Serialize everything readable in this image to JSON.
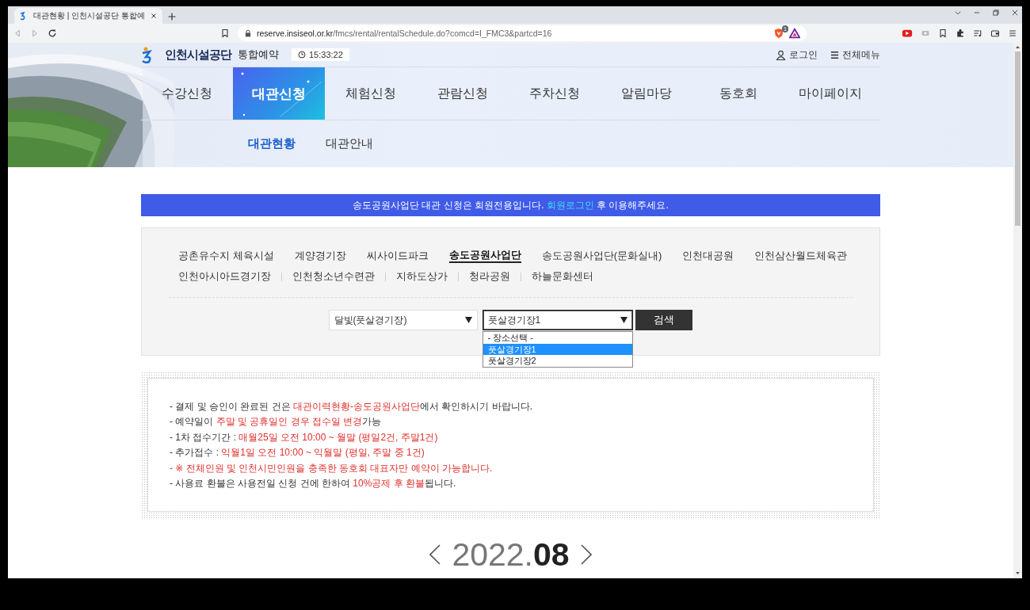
{
  "browser": {
    "tab_title": "대관현황 | 인천시설공단 통합예",
    "url_host": "reserve.insiseol.or.kr",
    "url_path": "/fmcs/rental/rentalSchedule.do?comcd=I_FMC3&partcd=16",
    "shield_badge": "1"
  },
  "header": {
    "logo": "인천시설공단",
    "service": "통합예약",
    "time": "15:33:22",
    "login": "로그인",
    "all_menu": "전체메뉴",
    "nav": [
      {
        "label": "수강신청",
        "selected": false
      },
      {
        "label": "대관신청",
        "selected": true
      },
      {
        "label": "체험신청",
        "selected": false
      },
      {
        "label": "관람신청",
        "selected": false
      },
      {
        "label": "주차신청",
        "selected": false
      },
      {
        "label": "알림마당",
        "selected": false
      },
      {
        "label": "동호회",
        "selected": false
      },
      {
        "label": "마이페이지",
        "selected": false
      }
    ],
    "subnav": [
      {
        "label": "대관현황",
        "selected": true
      },
      {
        "label": "대관안내",
        "selected": false
      }
    ]
  },
  "banner": {
    "before": "송도공원사업단 대관 신청은 회원전용입니다.",
    "link": "회원로그인",
    "after": "후 이용해주세요."
  },
  "facility_rows": [
    [
      {
        "label": "공촌유수지 체육시설",
        "selected": false
      },
      {
        "label": "계양경기장",
        "selected": false
      },
      {
        "label": "씨사이드파크",
        "selected": false
      },
      {
        "label": "송도공원사업단",
        "selected": true
      },
      {
        "label": "송도공원사업단(문화실내)",
        "selected": false
      },
      {
        "label": "인천대공원",
        "selected": false
      },
      {
        "label": "인천삼산월드체육관",
        "selected": false
      }
    ],
    [
      {
        "label": "인천아시아드경기장",
        "selected": false
      },
      {
        "label": "인천청소년수련관",
        "selected": false
      },
      {
        "label": "지하도상가",
        "selected": false
      },
      {
        "label": "청라공원",
        "selected": false
      },
      {
        "label": "하늘문화센터",
        "selected": false
      }
    ]
  ],
  "search": {
    "selects": [
      {
        "value": "달빛(풋살경기장)",
        "open": false
      },
      {
        "value": "풋살경기장1",
        "open": true,
        "options": [
          {
            "label": "- 장소선택 -",
            "selected": false
          },
          {
            "label": "풋살경기장1",
            "selected": true
          },
          {
            "label": "풋살경기장2",
            "selected": false
          }
        ]
      }
    ],
    "button": "검색"
  },
  "notices": [
    [
      {
        "text": "- 결제 및 승인이 완료된 건은 ",
        "highlight": false
      },
      {
        "text": "대관이력현황-송도공원사업단",
        "highlight": true
      },
      {
        "text": "에서 확인하시기 바랍니다.",
        "highlight": false
      }
    ],
    [
      {
        "text": "- 예약일이 ",
        "highlight": false
      },
      {
        "text": "주말 및 공휴일인 경우 접수일 변경",
        "highlight": true
      },
      {
        "text": "가능",
        "highlight": false
      }
    ],
    [
      {
        "text": "- 1차 접수기간 : ",
        "highlight": false
      },
      {
        "text": "매월25일 오전 10:00 ~ 월말 (평일2건, 주말1건)",
        "highlight": true
      }
    ],
    [
      {
        "text": "- 추가접수 : ",
        "highlight": false
      },
      {
        "text": "익월1일 오전 10:00 ~ 익월말 (평일, 주말 중 1건)",
        "highlight": true
      }
    ],
    [
      {
        "text": "- ※ 전체인원 및 인천시민인원을 충족한 동호회 대표자만 예약이 가능합니다.",
        "highlight": true
      }
    ],
    [
      {
        "text": "- 사용료 환불은 사용전일 신청 건에 한하여 ",
        "highlight": false
      },
      {
        "text": "10%공제 후 환불",
        "highlight": true
      },
      {
        "text": "됩니다.",
        "highlight": false
      }
    ]
  ],
  "month": {
    "year": "2022.",
    "month": "08"
  }
}
